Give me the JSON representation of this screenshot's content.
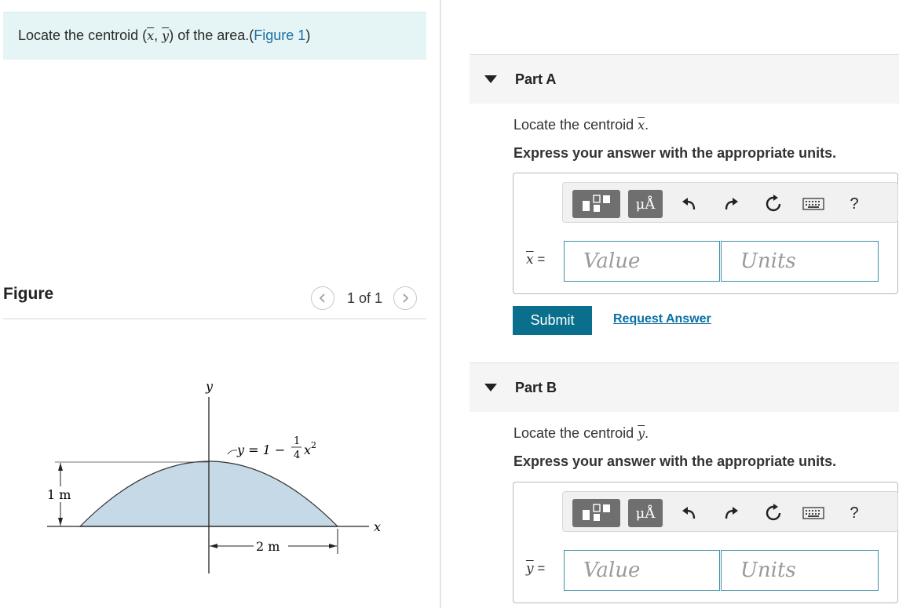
{
  "problem": {
    "text_before": "Locate the centroid (",
    "x_symbol": "x",
    "separator": ", ",
    "y_symbol": "y",
    "text_after": ") of the area.(",
    "figure_link": "Figure 1",
    "text_close": ")"
  },
  "figure_panel": {
    "title": "Figure",
    "prev_icon": "chevron-left-icon",
    "next_icon": "chevron-right-icon",
    "counter": "1 of 1",
    "diagram": {
      "y_axis": "y",
      "x_axis": "x",
      "equation_lhs": "y = 1 −",
      "eq_num": "1",
      "eq_den": "4",
      "eq_var": "x",
      "eq_exp": "2",
      "height_label": "1 m",
      "width_label": "2 m",
      "fill_color": "#c5d9e6"
    }
  },
  "parts": [
    {
      "title": "Part A",
      "prompt_before": "Locate the centroid ",
      "symbol": "x",
      "prompt_after": ".",
      "instruction": "Express your answer with the appropriate units.",
      "var_label_after": " =",
      "value_placeholder": "Value",
      "units_placeholder": "Units"
    },
    {
      "title": "Part B",
      "prompt_before": "Locate the centroid ",
      "symbol": "y",
      "prompt_after": ".",
      "instruction": "Express your answer with the appropriate units.",
      "var_label_after": " =",
      "value_placeholder": "Value",
      "units_placeholder": "Units"
    }
  ],
  "toolbar": {
    "units_button": "μÅ",
    "help": "?",
    "icons": [
      "templates-icon",
      "units-icon",
      "undo-icon",
      "redo-icon",
      "reset-icon",
      "keyboard-icon",
      "help-icon"
    ]
  },
  "actions": {
    "submit": "Submit",
    "request_answer": "Request Answer"
  },
  "colors": {
    "banner_bg": "#e5f4f4",
    "link": "#1a6fa5",
    "submit_bg": "#0a6f8c",
    "input_border": "#3d8fa7"
  }
}
